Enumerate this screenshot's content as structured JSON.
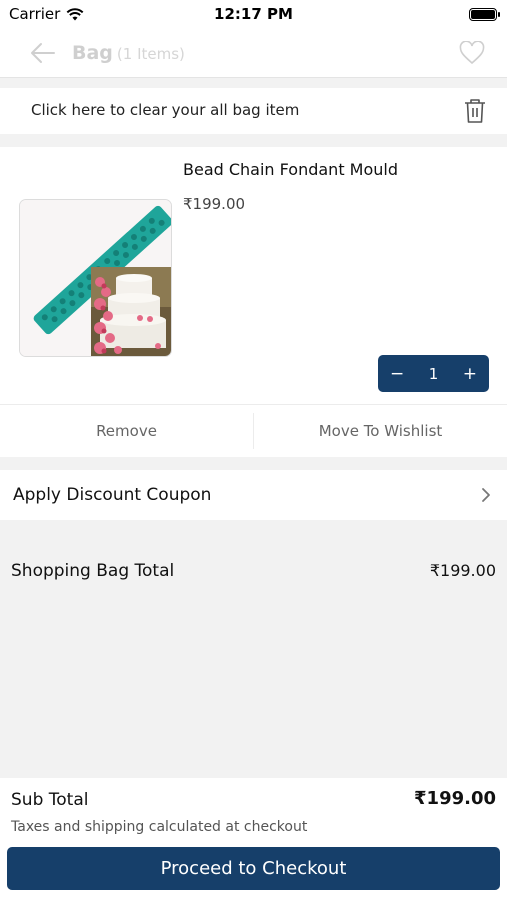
{
  "status_bar": {
    "carrier": "Carrier",
    "time": "12:17 PM"
  },
  "nav": {
    "title": "Bag",
    "count": "(1 Items)"
  },
  "clear_bag": {
    "text": "Click here to clear your all bag item"
  },
  "item": {
    "name": "Bead Chain Fondant Mould",
    "price": "₹199.00",
    "quantity": "1",
    "decrement": "−",
    "increment": "+",
    "remove_label": "Remove",
    "wishlist_label": "Move To Wishlist"
  },
  "coupon": {
    "label": "Apply Discount Coupon"
  },
  "bag_total": {
    "label": "Shopping Bag Total",
    "value": "₹199.00"
  },
  "footer": {
    "subtotal_label": "Sub Total",
    "subtotal_value": "₹199.00",
    "note": "Taxes and shipping calculated at checkout",
    "checkout_label": "Proceed to Checkout"
  },
  "colors": {
    "primary": "#163f6a",
    "background": "#f2f2f2"
  }
}
